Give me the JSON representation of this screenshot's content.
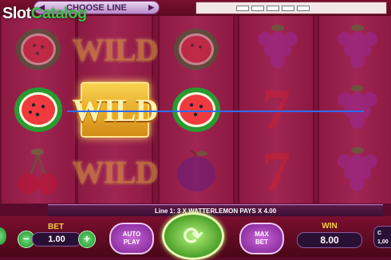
{
  "header": {
    "choose_line_label": "CHOOSE LINE",
    "choose_line_left_arrow": "◀",
    "choose_line_right_arrow": "▶",
    "logo_part1": "Slot",
    "logo_part2": "Catalog"
  },
  "reels": [
    [
      "watermelon",
      "watermelon",
      "cherries"
    ],
    [
      "wild",
      "wild",
      "wild"
    ],
    [
      "watermelon",
      "watermelon",
      "plum"
    ],
    [
      "grapes",
      "seven",
      "seven"
    ],
    [
      "grapes",
      "grapes",
      "grapes"
    ]
  ],
  "symbols": {
    "wild_text": "WILD",
    "seven_text": "7"
  },
  "info": {
    "message": "Line 1: 3 X WATTERLEMON PAYS X 4.00"
  },
  "controls": {
    "bet_label": "BET",
    "bet_value": "1.00",
    "minus": "−",
    "plus": "+",
    "auto_play_label": "AUTO PLAY",
    "max_bet_label": "MAX BET",
    "win_label": "WIN",
    "win_value": "8.00",
    "credit_label": "C",
    "credit_value": "1,00"
  },
  "colors": {
    "payline": "#2d6cff",
    "gold": "#f4d03a",
    "spin_green": "#4aa028"
  }
}
